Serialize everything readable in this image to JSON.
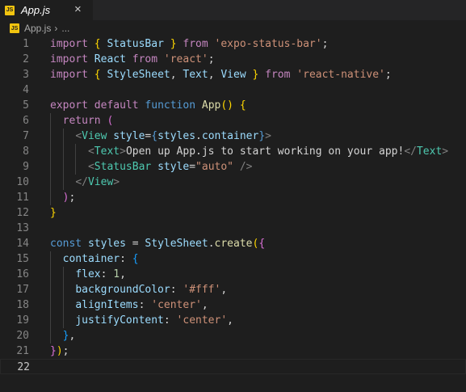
{
  "tab": {
    "icon": "JS",
    "name": "App.js",
    "close": "×"
  },
  "breadcrumb": {
    "icon": "JS",
    "file": "App.js",
    "sep": "›",
    "more": "..."
  },
  "colors": {
    "keyword": "#569cd6",
    "control": "#c586c0",
    "string": "#ce9178",
    "function": "#dcdcaa",
    "variable": "#9cdcfe",
    "type": "#4ec9b0",
    "number": "#b5cea8"
  },
  "lines": [
    {
      "n": "1",
      "t": [
        [
          "c",
          "import"
        ],
        [
          "p",
          " "
        ],
        [
          "b1",
          "{"
        ],
        [
          "p",
          " "
        ],
        [
          "v",
          "StatusBar"
        ],
        [
          "p",
          " "
        ],
        [
          "b1",
          "}"
        ],
        [
          "p",
          " "
        ],
        [
          "c",
          "from"
        ],
        [
          "p",
          " "
        ],
        [
          "s",
          "'expo-status-bar'"
        ],
        [
          "p",
          ";"
        ]
      ]
    },
    {
      "n": "2",
      "t": [
        [
          "c",
          "import"
        ],
        [
          "p",
          " "
        ],
        [
          "v",
          "React"
        ],
        [
          "p",
          " "
        ],
        [
          "c",
          "from"
        ],
        [
          "p",
          " "
        ],
        [
          "s",
          "'react'"
        ],
        [
          "p",
          ";"
        ]
      ]
    },
    {
      "n": "3",
      "t": [
        [
          "c",
          "import"
        ],
        [
          "p",
          " "
        ],
        [
          "b1",
          "{"
        ],
        [
          "p",
          " "
        ],
        [
          "v",
          "StyleSheet"
        ],
        [
          "p",
          ", "
        ],
        [
          "v",
          "Text"
        ],
        [
          "p",
          ", "
        ],
        [
          "v",
          "View"
        ],
        [
          "p",
          " "
        ],
        [
          "b1",
          "}"
        ],
        [
          "p",
          " "
        ],
        [
          "c",
          "from"
        ],
        [
          "p",
          " "
        ],
        [
          "s",
          "'react-native'"
        ],
        [
          "p",
          ";"
        ]
      ]
    },
    {
      "n": "4",
      "t": []
    },
    {
      "n": "5",
      "t": [
        [
          "c",
          "export"
        ],
        [
          "p",
          " "
        ],
        [
          "c",
          "default"
        ],
        [
          "p",
          " "
        ],
        [
          "k",
          "function"
        ],
        [
          "p",
          " "
        ],
        [
          "f",
          "App"
        ],
        [
          "b1",
          "()"
        ],
        [
          "p",
          " "
        ],
        [
          "b1",
          "{"
        ]
      ]
    },
    {
      "n": "6",
      "t": [
        [
          "p",
          "  "
        ],
        [
          "c",
          "return"
        ],
        [
          "p",
          " "
        ],
        [
          "b2",
          "("
        ]
      ]
    },
    {
      "n": "7",
      "t": [
        [
          "p",
          "    "
        ],
        [
          "gy",
          "<"
        ],
        [
          "t",
          "View"
        ],
        [
          "p",
          " "
        ],
        [
          "v",
          "style"
        ],
        [
          "p",
          "="
        ],
        [
          "k",
          "{"
        ],
        [
          "v",
          "styles"
        ],
        [
          "p",
          "."
        ],
        [
          "v",
          "container"
        ],
        [
          "k",
          "}"
        ],
        [
          "gy",
          ">"
        ]
      ]
    },
    {
      "n": "8",
      "t": [
        [
          "p",
          "      "
        ],
        [
          "gy",
          "<"
        ],
        [
          "t",
          "Text"
        ],
        [
          "gy",
          ">"
        ],
        [
          "p",
          "Open up App.js to start working on your app!"
        ],
        [
          "gy",
          "</"
        ],
        [
          "t",
          "Text"
        ],
        [
          "gy",
          ">"
        ]
      ]
    },
    {
      "n": "9",
      "t": [
        [
          "p",
          "      "
        ],
        [
          "gy",
          "<"
        ],
        [
          "t",
          "StatusBar"
        ],
        [
          "p",
          " "
        ],
        [
          "v",
          "style"
        ],
        [
          "p",
          "="
        ],
        [
          "s",
          "\"auto\""
        ],
        [
          "p",
          " "
        ],
        [
          "gy",
          "/>"
        ]
      ]
    },
    {
      "n": "10",
      "t": [
        [
          "p",
          "    "
        ],
        [
          "gy",
          "</"
        ],
        [
          "t",
          "View"
        ],
        [
          "gy",
          ">"
        ]
      ]
    },
    {
      "n": "11",
      "t": [
        [
          "p",
          "  "
        ],
        [
          "b2",
          ")"
        ],
        [
          "p",
          ";"
        ]
      ]
    },
    {
      "n": "12",
      "t": [
        [
          "b1",
          "}"
        ]
      ]
    },
    {
      "n": "13",
      "t": []
    },
    {
      "n": "14",
      "t": [
        [
          "k",
          "const"
        ],
        [
          "p",
          " "
        ],
        [
          "v",
          "styles"
        ],
        [
          "p",
          " = "
        ],
        [
          "v",
          "StyleSheet"
        ],
        [
          "p",
          "."
        ],
        [
          "f",
          "create"
        ],
        [
          "b1",
          "("
        ],
        [
          "b2",
          "{"
        ]
      ]
    },
    {
      "n": "15",
      "t": [
        [
          "p",
          "  "
        ],
        [
          "v",
          "container"
        ],
        [
          "p",
          ": "
        ],
        [
          "b3",
          "{"
        ]
      ]
    },
    {
      "n": "16",
      "t": [
        [
          "p",
          "    "
        ],
        [
          "v",
          "flex"
        ],
        [
          "p",
          ": "
        ],
        [
          "n",
          "1"
        ],
        [
          "p",
          ","
        ]
      ]
    },
    {
      "n": "17",
      "t": [
        [
          "p",
          "    "
        ],
        [
          "v",
          "backgroundColor"
        ],
        [
          "p",
          ": "
        ],
        [
          "s",
          "'#fff'"
        ],
        [
          "p",
          ","
        ]
      ]
    },
    {
      "n": "18",
      "t": [
        [
          "p",
          "    "
        ],
        [
          "v",
          "alignItems"
        ],
        [
          "p",
          ": "
        ],
        [
          "s",
          "'center'"
        ],
        [
          "p",
          ","
        ]
      ]
    },
    {
      "n": "19",
      "t": [
        [
          "p",
          "    "
        ],
        [
          "v",
          "justifyContent"
        ],
        [
          "p",
          ": "
        ],
        [
          "s",
          "'center'"
        ],
        [
          "p",
          ","
        ]
      ]
    },
    {
      "n": "20",
      "t": [
        [
          "p",
          "  "
        ],
        [
          "b3",
          "}"
        ],
        [
          "p",
          ","
        ]
      ]
    },
    {
      "n": "21",
      "t": [
        [
          "b2",
          "}"
        ],
        [
          "b1",
          ")"
        ],
        [
          "p",
          ";"
        ]
      ]
    },
    {
      "n": "22",
      "t": []
    }
  ]
}
